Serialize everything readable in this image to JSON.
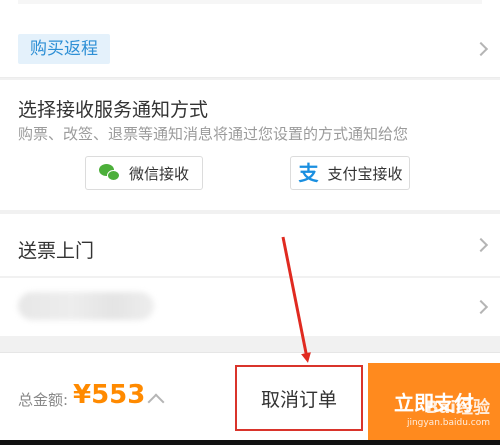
{
  "return_trip": {
    "label": "购买返程"
  },
  "notify": {
    "title": "选择接收服务通知方式",
    "desc": "购票、改签、退票等通知消息将通过您设置的方式通知给您",
    "wechat_label": "微信接收",
    "alipay_label": "支付宝接收"
  },
  "delivery": {
    "label": "送票上门"
  },
  "bottom": {
    "total_label": "总金额:",
    "total_amount": "¥553",
    "cancel_label": "取消订单",
    "pay_label": "立即支付"
  },
  "watermark": {
    "main": "Bai经验",
    "sub": "jingyan.baidu.com"
  },
  "colors": {
    "accent": "#ff8a00",
    "annotation": "#d9342b",
    "tag_bg": "#e4f1fb",
    "tag_text": "#2d8fd5"
  }
}
